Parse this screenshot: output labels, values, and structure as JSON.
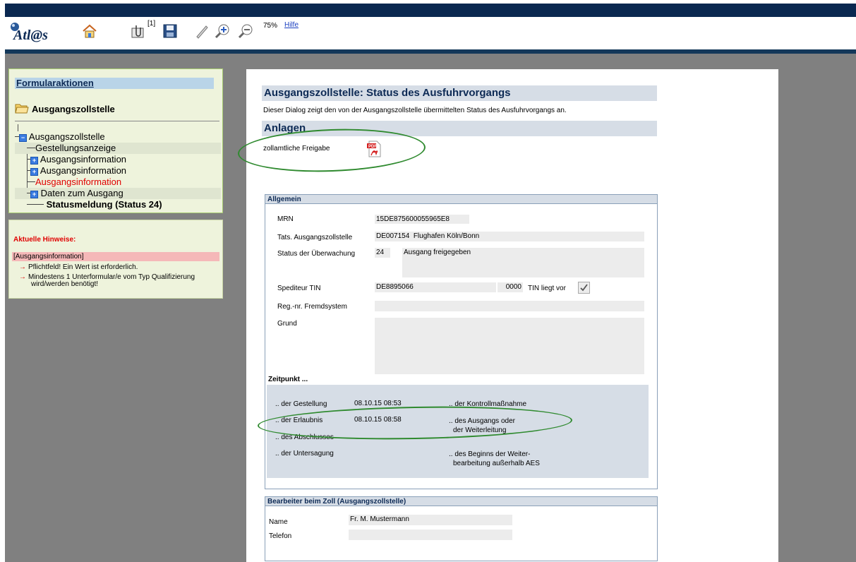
{
  "toolbar": {
    "logo_text": "Atl@s",
    "attach_count": "[1]",
    "zoom": "75%",
    "help_link": "Hilfe"
  },
  "sidebar": {
    "title": "Formularaktionen",
    "root_label": "Ausgangszollstelle",
    "tree": [
      {
        "label": "Ausgangszollstelle",
        "kind": "minus"
      },
      {
        "label": "Gestellungsanzeige",
        "kind": "leaf"
      },
      {
        "label": "Ausgangsinformation",
        "kind": "plus"
      },
      {
        "label": "Ausgangsinformation",
        "kind": "plus"
      },
      {
        "label": "Ausgangsinformation",
        "kind": "leaf-red"
      },
      {
        "label": "Daten zum Ausgang",
        "kind": "plus"
      },
      {
        "label": "Statusmeldung (Status 24)",
        "kind": "leaf-bold"
      }
    ]
  },
  "hints": {
    "title": "Aktuelle Hinweise:",
    "band": "[Ausgangsinformation]",
    "items": [
      "Pflichtfeld! Ein Wert ist erforderlich.",
      "Mindestens 1 Unterformular/e vom Typ Qualifizierung",
      "wird/werden benötigt!"
    ]
  },
  "form": {
    "title": "Ausgangszollstelle: Status des Ausfuhrvorgangs",
    "description": "Dieser Dialog zeigt den von der Ausgangszollstelle übermittelten Status des Ausfuhrvorgangs an.",
    "anlagen_title": "Anlagen",
    "attachment_label": "zollamtliche Freigabe",
    "allgemein": {
      "title": "Allgemein",
      "mrn_label": "MRN",
      "mrn_value": "15DE875600055965E8",
      "tats_label": "Tats. Ausgangszollstelle",
      "tats_code": "DE007154",
      "tats_name": "Flughafen Köln/Bonn",
      "status_label": "Status der Überwachung",
      "status_code": "24",
      "status_text": "Ausgang freigegeben",
      "spediteur_label": "Spediteur TIN",
      "spediteur_value": "DE8895066",
      "spediteur_suffix": "0000",
      "tin_label": "TIN liegt vor",
      "regnr_label": "Reg.-nr. Fremdsystem",
      "grund_label": "Grund"
    },
    "zeitpunkt": {
      "title": "Zeitpunkt ...",
      "gestellung_label": ".. der Gestellung",
      "gestellung_value": "08.10.15 08:53",
      "kontroll_label": ".. der Kontrollmaßnahme",
      "erlaubnis_label": ".. der Erlaubnis",
      "erlaubnis_value": "08.10.15 08:58",
      "ausgang_label_1": ".. des Ausgangs oder",
      "ausgang_label_2": "der Weiterleitung",
      "abschluss_label": ".. des Abschlusses",
      "untersagung_label": ".. der Untersagung",
      "beginn_label_1": ".. des Beginns der Weiter-",
      "beginn_label_2": "bearbeitung außerhalb AES"
    },
    "bearbeiter": {
      "title": "Bearbeiter beim Zoll (Ausgangszollstelle)",
      "name_label": "Name",
      "name_value": "Fr. M. Mustermann",
      "telefon_label": "Telefon",
      "telefon_value": ""
    }
  },
  "colors": {
    "accent_green": "#2f8a2f",
    "header_navy": "#0a2850"
  }
}
